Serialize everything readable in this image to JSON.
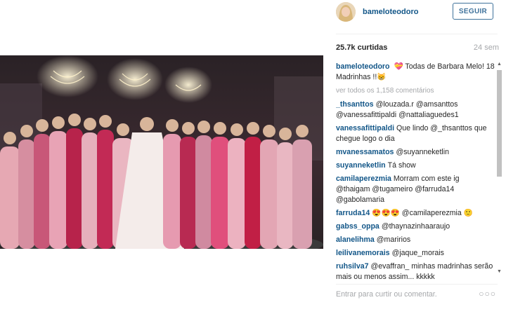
{
  "post": {
    "photo_alt": "",
    "likes": "25.7k curtidas",
    "age": "24 sem"
  },
  "header": {
    "username": "bameloteodoro",
    "follow_label": "SEGUIR"
  },
  "caption": {
    "username": "bameloteodoro",
    "text": "💝 Todas de Barbara Melo! 18 Madrinhas !!😸"
  },
  "view_all": "ver todos os 1,158 comentários",
  "comments": [
    {
      "user": "_thsanttos",
      "text": "@louzada.r @amsanttos @vanessafittipaldi @nattaliaguedes1"
    },
    {
      "user": "vanessafittipaldi",
      "text": "Que lindo @_thsanttos que chegue logo o dia"
    },
    {
      "user": "mvanessamatos",
      "text": "@suyanneketlin"
    },
    {
      "user": "suyanneketlin",
      "text": "Tá show"
    },
    {
      "user": "camilaperezmia",
      "text": "Morram com este ig @thaigam @tugameiro @farruda14 @gabolamaria"
    },
    {
      "user": "farruda14",
      "text": "😍😍😍 @camilaperezmia 🙂"
    },
    {
      "user": "gabss_oppa",
      "text": "@thaynazinhaaraujo"
    },
    {
      "user": "alanelihma",
      "text": "@maririos"
    },
    {
      "user": "leilivanemorais",
      "text": "@jaque_morais"
    },
    {
      "user": "ruhsilva7",
      "text": "@evaffran_ minhas madrinhas serão mais ou menos assim... kkkkk"
    }
  ],
  "footer": {
    "placeholder": "Entrar para curtir ou comentar.",
    "options": "○○○"
  },
  "colors": {
    "link": "#125688",
    "follow": "#3f729b",
    "muted": "#a5a7aa"
  }
}
